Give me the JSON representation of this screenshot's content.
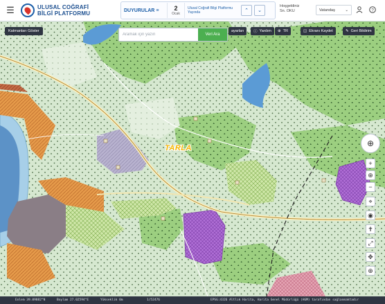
{
  "header": {
    "brand_line1": "ULUSAL COĞRAFİ",
    "brand_line2": "BİLGİ PLATFORMU",
    "announce_label": "DUYURULAR",
    "announce_day": "2",
    "announce_month": "Ocak",
    "announce_text": "Ulusal Coğrafi Bilgi Platformu Yayında",
    "welcome_line1": "Hoşgeldiniz",
    "welcome_line2": "Sn. OKU",
    "language": "Vatandaş"
  },
  "toolbar": {
    "layers_label": "Katmanları Göster",
    "search_placeholder": "Aramak için yazın",
    "search_button": "Veri Ara",
    "ayarlar": "ayarları",
    "yardim": "Yardım",
    "tr": "TR",
    "save_screen": "Ekranı Kaydet",
    "feedback": "Geri Bildirim"
  },
  "map": {
    "label": "TARLA",
    "icons": {
      "compass": "compass-icon",
      "zoom_in": "plus-icon",
      "zoom_out": "minus-icon",
      "globe": "globe-icon",
      "location": "location-pin-icon",
      "eye": "eye-icon",
      "person": "person-icon",
      "fullscreen": "fullscreen-icon",
      "move": "move-icon",
      "target": "target-icon"
    }
  },
  "status": {
    "enlem": "Enlem  39.09882°N",
    "boylam": "Boylam  27.02594°E",
    "yukseklik": "Yükseklik  0m",
    "scale": "1/52476",
    "credit": "EPSG:4326 Altlık Harita, Harita Genel Müdürlüğü (HGM) tarafından sağlanmaktadır"
  }
}
